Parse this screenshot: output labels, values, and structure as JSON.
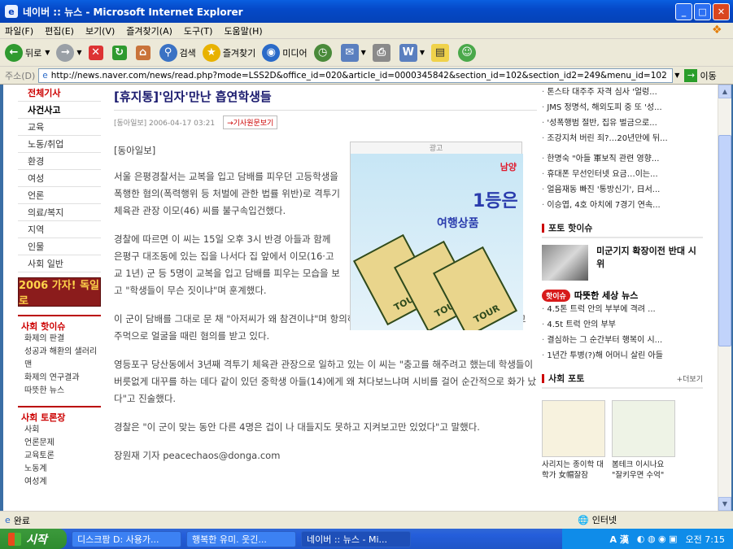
{
  "window": {
    "title": "네이버 :: 뉴스 - Microsoft Internet Explorer",
    "min": "_",
    "max": "□",
    "close": "✕"
  },
  "menu": [
    "파일(F)",
    "편집(E)",
    "보기(V)",
    "즐겨찾기(A)",
    "도구(T)",
    "도움말(H)"
  ],
  "toolbar": {
    "back": "뒤로",
    "search": "검색",
    "favorites": "즐겨찾기",
    "media": "미디어"
  },
  "address": {
    "label": "주소(D)",
    "url": "http://news.naver.com/news/read.php?mode=LSS2D&office_id=020&article_id=0000345842&section_id=102&section_id2=249&menu_id=102",
    "go": "이동"
  },
  "nav": {
    "items": [
      "전체기사",
      "사건사고",
      "교육",
      "노동/취업",
      "환경",
      "여성",
      "언론",
      "의료/복지",
      "지역",
      "인물",
      "사회 일반"
    ],
    "banner": "2006 가자! 독일로",
    "hot_title": "사회 핫이슈",
    "hot_items": [
      "화제의 판결",
      "성공과 해환의 샐러리맨",
      "화제의 연구결과",
      "따뜻한 뉴스"
    ],
    "debate_title": "사회 토론장",
    "debate_items": [
      "사회",
      "언론문제",
      "교육토론",
      "노동계",
      "여성계"
    ]
  },
  "article": {
    "title": "[휴지통]'임자'만난 흡연학생들",
    "meta": "[동아일보]  2006-04-17 03:21",
    "original_btn": "기사원문보기",
    "source": "[동아일보]",
    "paragraphs": [
      "서울 은평경찰서는 교복을 입고 담배를 피우던 고등학생을 폭행한 혐의(폭력행위 등 처벌에 관한 법률 위반)로 격투기 체육관 관장 이모(46) 씨를 불구속입건했다.",
      "경찰에 따르면 이 씨는 15일 오후 3시 반경 아들과 함께 은평구 대조동에 있는 집을 나서다 집 앞에서 이모(16·고교 1년) 군 등 5명이 교복을 입고 담배를 피우는 모습을 보고 \"학생들이 무슨 짓이냐\"며 훈계했다.",
      "이 군이 담배를 그대로 문 채 \"아저씨가 왜 참견이냐\"며 항의하자 이 씨는 이 군을 몰러 허벅지를 발로 차고 주먹으로 얼굴을 때린 혐의를 받고 있다.",
      "영등포구 당산동에서 3년째 격투기 체육관 관장으로 일하고 있는 이 씨는 \"충고를 해주려고 했는데 학생들이 버릇없게 대꾸를 하는 데다 같이 있던 중학생 아들(14)에게 왜 쳐다보느냐며 시비를 걸어 순간적으로 화가 났다\"고 진술했다.",
      "경찰은 \"이 군이 맞는 동안 다른 4명은 겁이 나 대들지도 못하고 지켜보고만 있었다\"고 말했다.",
      "장원재 기자 peacechaos@donga.com"
    ]
  },
  "ad": {
    "label": "광고",
    "brand": "남양",
    "headline": "1등은",
    "sub": "여행상품",
    "ticket": "TOUR"
  },
  "right": {
    "top_items": [
      "톤스타 대주주 자격 심사 '얼렁...",
      "JMS 정명석, 해외도피 중 또 '성...",
      "'성폭행범 절반, 집유 벌금으로...",
      "조강지처 버린 죄?…20년만에 뒤...",
      "한명숙 \"아들 軍보직 관련 영향...",
      "휴대폰 무선인터넷 요금…이는...",
      "얼음재동 빠진 '통방신기', 日서...",
      "이승엽, 4호 아치에 7경기 연속..."
    ],
    "photo_title": "포토 핫이슈",
    "photo_caption": "미군기지 확장이전 반대 시위",
    "warm_badge": "핫이슈",
    "warm_title": "따뜻한 세상 뉴스",
    "warm_items": [
      "4.5톤 트럭 안의 부부에 격려 ...",
      "4.5t 트럭 안의 부부",
      "결심하는 그 순간부터 행복이 시...",
      "1년간 투병(?)해 어머니 살린 아들"
    ],
    "photo2_title": "사회 포토",
    "more": "+더보기",
    "thumbs": [
      {
        "caption": "사리지는 종이학 대학가 女帽잘잠"
      },
      {
        "caption": "봄테크 이시나요 \"잘키우면 수억\""
      }
    ]
  },
  "status": {
    "left": "완료",
    "zone": "인터넷"
  },
  "taskbar": {
    "start": "시작",
    "tasks": [
      "디스크팜 D: 사용가...",
      "행복한 유미. 웃긴...",
      "네이버 :: 뉴스 - Mi..."
    ],
    "time": "오전 7:15",
    "lang": "A 漢"
  }
}
